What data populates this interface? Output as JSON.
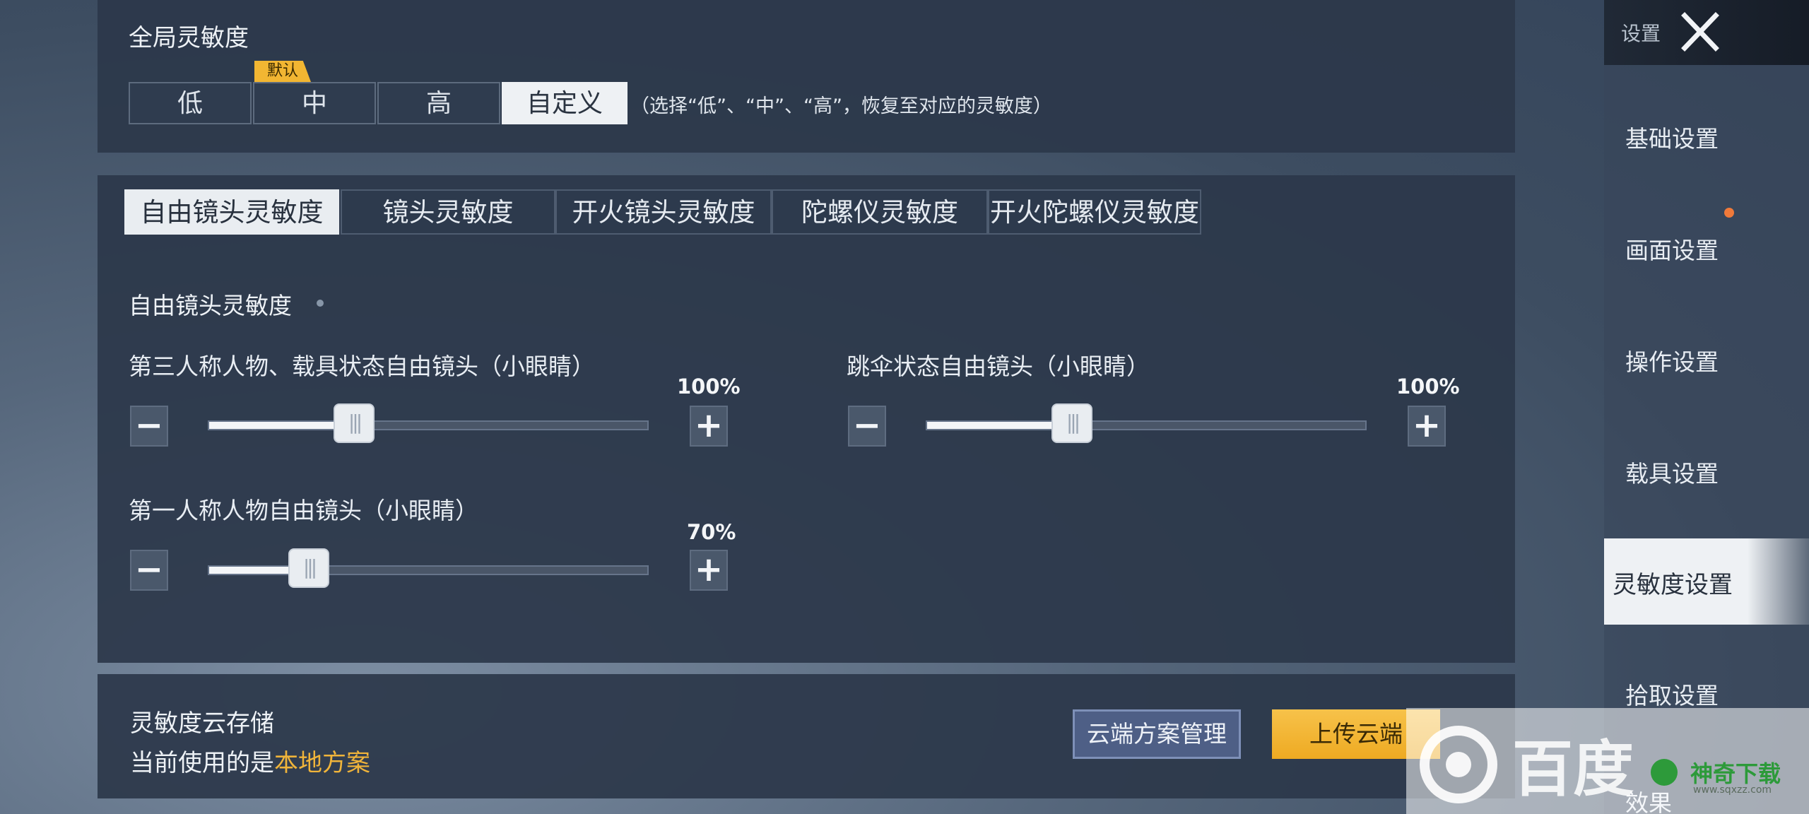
{
  "global": {
    "title": "全局灵敏度",
    "badge": "默认",
    "presets": [
      "低",
      "中",
      "高",
      "自定义"
    ],
    "hint": "（选择“低”、“中”、“高”，恢复至对应的灵敏度）"
  },
  "tabs": [
    "自由镜头灵敏度",
    "镜头灵敏度",
    "开火镜头灵敏度",
    "陀螺仪灵敏度",
    "开火陀螺仪灵敏度"
  ],
  "section": {
    "title": "自由镜头灵敏度",
    "sliders": [
      {
        "label": "第三人称人物、载具状态自由镜头（小眼睛）",
        "value_text": "100%",
        "value": 0.34
      },
      {
        "label": "跳伞状态自由镜头（小眼睛）",
        "value_text": "100%",
        "value": 0.34
      },
      {
        "label": "第一人称人物自由镜头（小眼睛）",
        "value_text": "70%",
        "value": 0.23
      }
    ]
  },
  "cloud": {
    "title": "灵敏度云存储",
    "current_prefix": "当前使用的是",
    "current_value": "本地方案",
    "manage_label": "云端方案管理",
    "upload_label": "上传云端"
  },
  "sidebar": {
    "title": "设置",
    "items": [
      "基础设置",
      "画面设置",
      "操作设置",
      "载具设置",
      "灵敏度设置",
      "拾取设置",
      "效果"
    ],
    "active_index": 4
  },
  "watermark": {
    "text1": "百度",
    "text2": "神奇下载",
    "text3": "www.sqxzz.com"
  },
  "colors": {
    "accent": "#f2b632",
    "highlight_text": "#f0b43a",
    "notify_dot": "#f07a3a"
  }
}
